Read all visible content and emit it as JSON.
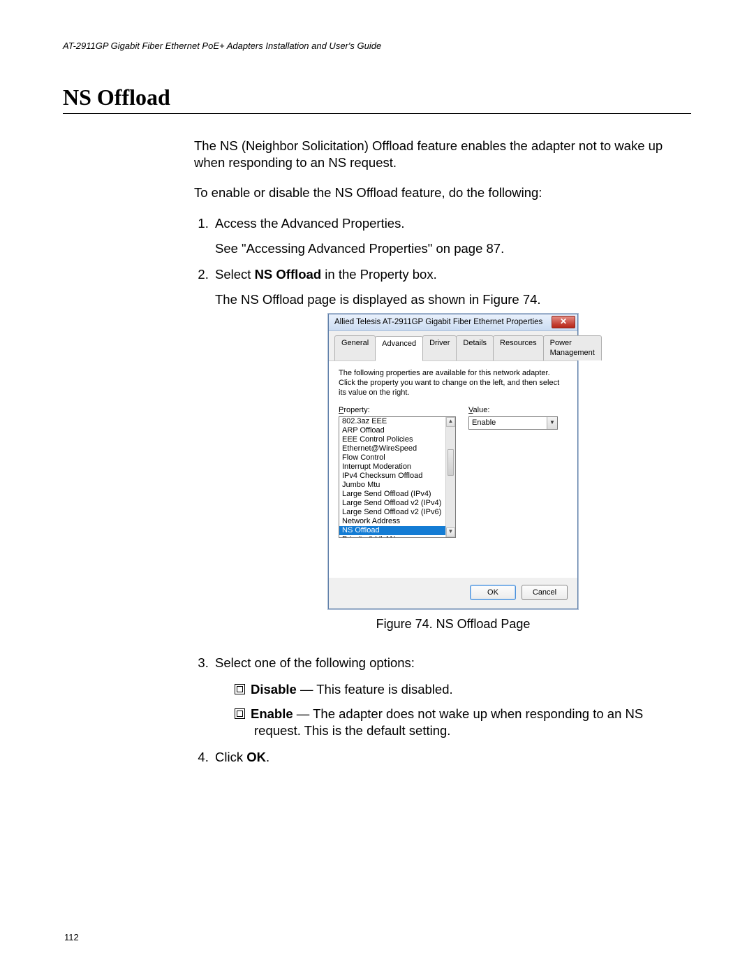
{
  "header": "AT-2911GP Gigabit Fiber Ethernet PoE+ Adapters Installation and User's Guide",
  "section_title": "NS Offload",
  "intro_para": "The NS (Neighbor Solicitation) Offload feature enables the adapter not to wake up when responding to an NS request.",
  "lead_para": "To enable or disable the NS Offload feature, do the following:",
  "steps": {
    "s1": "Access the Advanced Properties.",
    "s1_sub": "See \"Accessing Advanced Properties\" on page 87.",
    "s2_pre": "Select ",
    "s2_bold": "NS Offload",
    "s2_post": " in the Property box.",
    "s2_sub": "The NS Offload page is displayed as shown in Figure 74.",
    "s3": "Select one of the following options:",
    "opt1_bold": "Disable",
    "opt1_text": " — This feature is disabled.",
    "opt2_bold": "Enable",
    "opt2_text": " — The adapter does not wake up when responding to an NS request. This is the default setting.",
    "s4_pre": "Click ",
    "s4_bold": "OK",
    "s4_post": "."
  },
  "figure_caption": "Figure 74. NS Offload Page",
  "page_number": "112",
  "dialog": {
    "title": "Allied Telesis AT-2911GP Gigabit Fiber Ethernet Properties",
    "close_glyph": "✕",
    "tabs": [
      "General",
      "Advanced",
      "Driver",
      "Details",
      "Resources",
      "Power Management"
    ],
    "active_tab_index": 1,
    "explain": "The following properties are available for this network adapter. Click the property you want to change on the left, and then select its value on the right.",
    "property_label": "Property:",
    "value_label": "Value:",
    "properties": [
      "802.3az EEE",
      "ARP Offload",
      "EEE Control Policies",
      "Ethernet@WireSpeed",
      "Flow Control",
      "Interrupt Moderation",
      "IPv4 Checksum Offload",
      "Jumbo Mtu",
      "Large Send Offload (IPv4)",
      "Large Send Offload v2 (IPv4)",
      "Large Send Offload v2 (IPv6)",
      "Network Address",
      "NS Offload",
      "Priority & VLAN"
    ],
    "selected_property_index": 12,
    "value": "Enable",
    "dropdown_glyph": "▼",
    "scroll_up_glyph": "▲",
    "scroll_down_glyph": "▼",
    "ok_label": "OK",
    "cancel_label": "Cancel"
  }
}
